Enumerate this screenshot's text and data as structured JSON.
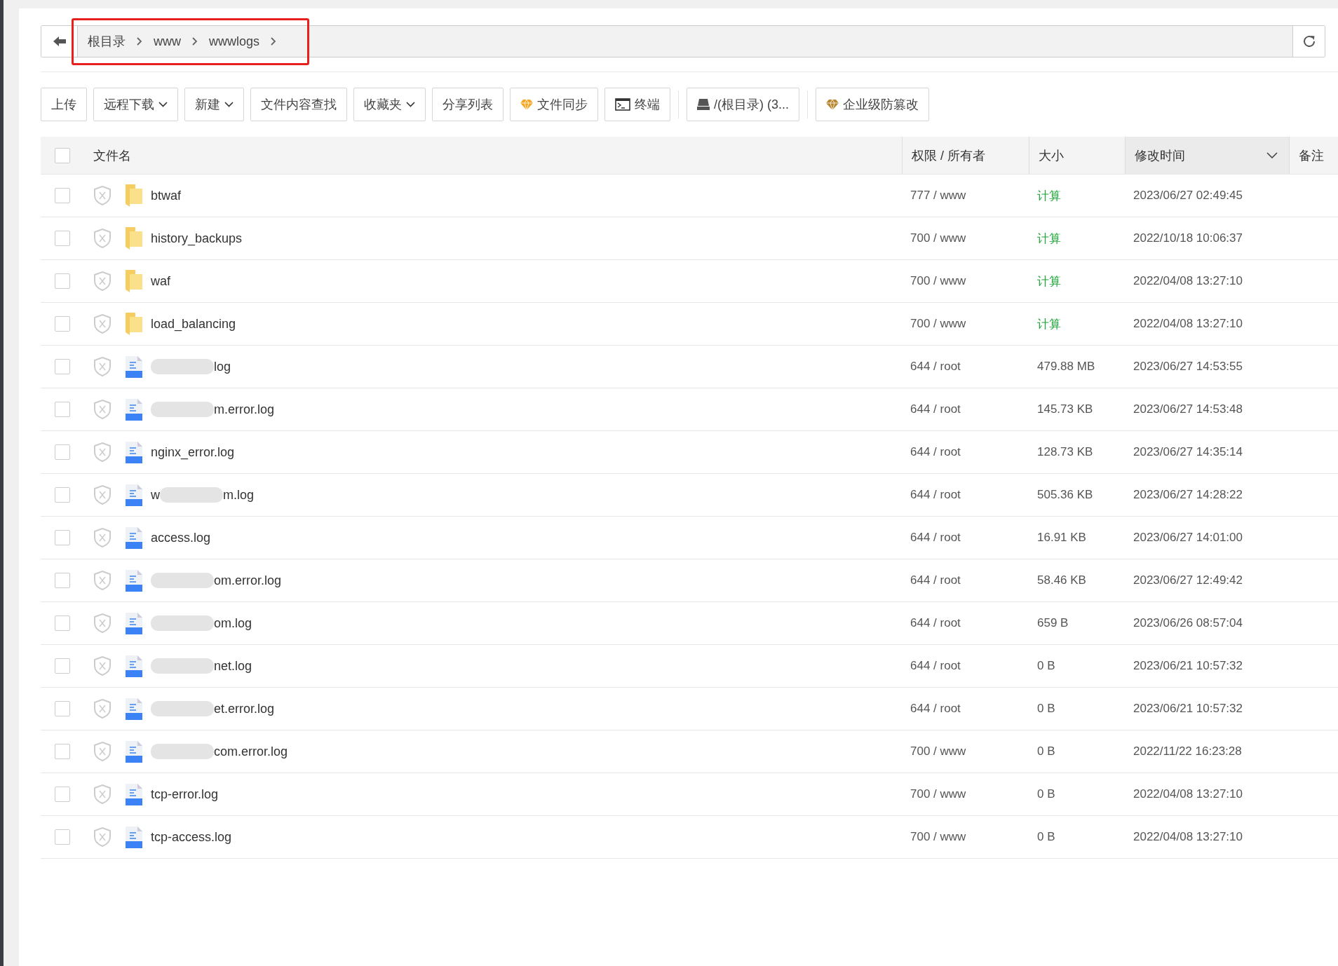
{
  "breadcrumb": {
    "crumbs": [
      "根目录",
      "www",
      "wwwlogs"
    ],
    "highlighted": true
  },
  "toolbar": [
    {
      "label": "上传",
      "kind": "plain"
    },
    {
      "label": "远程下载",
      "kind": "dropdown"
    },
    {
      "label": "新建",
      "kind": "dropdown"
    },
    {
      "label": "文件内容查找",
      "kind": "plain"
    },
    {
      "label": "收藏夹",
      "kind": "dropdown"
    },
    {
      "label": "分享列表",
      "kind": "plain"
    },
    {
      "label": "文件同步",
      "kind": "gem"
    },
    {
      "label": "终端",
      "kind": "terminal"
    },
    {
      "label": "/(根目录) (3...",
      "kind": "disk"
    },
    {
      "label": "企业级防篡改",
      "kind": "gem-gold"
    }
  ],
  "table": {
    "all_checked": false,
    "columns": [
      {
        "label": "文件名",
        "sorted": false
      },
      {
        "label": "权限 / 所有者",
        "sorted": false
      },
      {
        "label": "大小",
        "sorted": false
      },
      {
        "label": "修改时间",
        "sorted": true
      },
      {
        "label": "备注",
        "sorted": false
      }
    ],
    "rows": [
      {
        "kind": "folder",
        "checked": false,
        "name": "btwaf",
        "perms": "777 / www",
        "size": "计算",
        "size_link": true,
        "time": "2023/06/27 02:49:45"
      },
      {
        "kind": "folder",
        "checked": false,
        "name": "history_backups",
        "perms": "700 / www",
        "size": "计算",
        "size_link": true,
        "time": "2022/10/18 10:06:37"
      },
      {
        "kind": "folder",
        "checked": false,
        "name": "waf",
        "perms": "700 / www",
        "size": "计算",
        "size_link": true,
        "time": "2022/04/08 13:27:10"
      },
      {
        "kind": "folder",
        "checked": false,
        "name": "load_balancing",
        "perms": "700 / www",
        "size": "计算",
        "size_link": true,
        "time": "2022/04/08 13:27:10"
      },
      {
        "kind": "log",
        "checked": false,
        "redacted": true,
        "name": "log",
        "perms": "644 / root",
        "size": "479.88 MB",
        "size_link": false,
        "time": "2023/06/27 14:53:55"
      },
      {
        "kind": "log",
        "checked": false,
        "redacted": true,
        "name": "m.error.log",
        "perms": "644 / root",
        "size": "145.73 KB",
        "size_link": false,
        "time": "2023/06/27 14:53:48"
      },
      {
        "kind": "log",
        "checked": false,
        "name": "nginx_error.log",
        "perms": "644 / root",
        "size": "128.73 KB",
        "size_link": false,
        "time": "2023/06/27 14:35:14"
      },
      {
        "kind": "log",
        "checked": false,
        "redacted": true,
        "name_start": "w",
        "name": "m.log",
        "perms": "644 / root",
        "size": "505.36 KB",
        "size_link": false,
        "time": "2023/06/27 14:28:22"
      },
      {
        "kind": "log",
        "checked": false,
        "name": "access.log",
        "perms": "644 / root",
        "size": "16.91 KB",
        "size_link": false,
        "time": "2023/06/27 14:01:00"
      },
      {
        "kind": "log",
        "checked": false,
        "redacted": true,
        "name": "om.error.log",
        "perms": "644 / root",
        "size": "58.46 KB",
        "size_link": false,
        "time": "2023/06/27 12:49:42"
      },
      {
        "kind": "log",
        "checked": false,
        "redacted": true,
        "name": "om.log",
        "perms": "644 / root",
        "size": "659 B",
        "size_link": false,
        "time": "2023/06/26 08:57:04"
      },
      {
        "kind": "log",
        "checked": false,
        "redacted": true,
        "name": "net.log",
        "perms": "644 / root",
        "size": "0 B",
        "size_link": false,
        "time": "2023/06/21 10:57:32"
      },
      {
        "kind": "log",
        "checked": false,
        "redacted": true,
        "name": "et.error.log",
        "perms": "644 / root",
        "size": "0 B",
        "size_link": false,
        "time": "2023/06/21 10:57:32"
      },
      {
        "kind": "log",
        "checked": false,
        "redacted": true,
        "name": "com.error.log",
        "perms": "700 / www",
        "size": "0 B",
        "size_link": false,
        "time": "2022/11/22 16:23:28"
      },
      {
        "kind": "log",
        "checked": false,
        "name": "tcp-error.log",
        "perms": "700 / www",
        "size": "0 B",
        "size_link": false,
        "time": "2022/04/08 13:27:10"
      },
      {
        "kind": "log",
        "checked": false,
        "name": "tcp-access.log",
        "perms": "700 / www",
        "size": "0 B",
        "size_link": false,
        "time": "2022/04/08 13:27:10"
      }
    ]
  }
}
